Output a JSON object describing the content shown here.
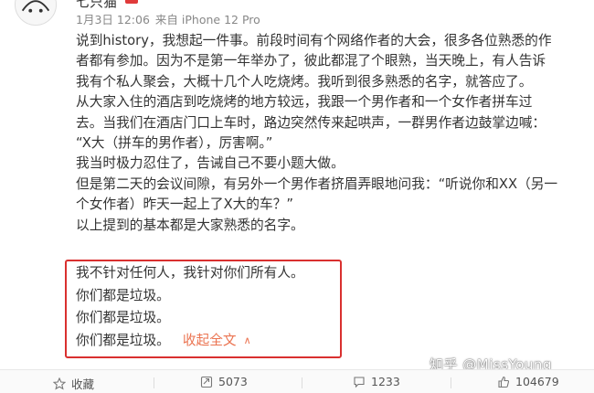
{
  "author": {
    "name": "七只猫"
  },
  "meta": {
    "date": "1月3日 12:06",
    "source_prefix": "来自",
    "device": "iPhone 12 Pro"
  },
  "post": {
    "lines": [
      "说到history，我想起一件事。前段时间有个网络作者的大会，很多各位熟悉的作",
      "者都有参加。因为不是第一年举办了，彼此都混了个眼熟，当天晚上，有人告诉",
      "我有个私人聚会，大概十几个人吃烧烤。我听到很多熟悉的名字，就答应了。",
      "从大家入住的酒店到吃烧烤的地方较远，我跟一个男作者和一个女作者拼车过",
      "去。当我们在酒店门口上车时，路边突然传来起哄声，一群男作者边鼓掌边喊：",
      "“X大（拼车的男作者），厉害啊。”",
      "我当时极力忍住了，告诫自己不要小题大做。",
      "但是第二天的会议间隙，有另外一个男作者挤眉弄眼地问我：“听说你和XX（另一",
      "个女作者）昨天一起上了X大的车？”",
      "以上提到的基本都是大家熟悉的名字。"
    ],
    "highlight": [
      "我不针对任何人，我针对你们所有人。",
      "你们都是垃圾。",
      "你们都是垃圾。",
      "你们都是垃圾。"
    ],
    "collapse_label": "收起全文",
    "accent_color": "#eb7350",
    "box_color": "#d9302f"
  },
  "watermark": "知乎 @MissYoung",
  "actions": {
    "favorite": {
      "label": "收藏",
      "icon": "star-icon"
    },
    "repost": {
      "count": "5073",
      "icon": "repost-icon"
    },
    "comment": {
      "count": "1233",
      "icon": "comment-icon"
    },
    "like": {
      "count": "104679",
      "icon": "thumbs-up-icon"
    }
  }
}
